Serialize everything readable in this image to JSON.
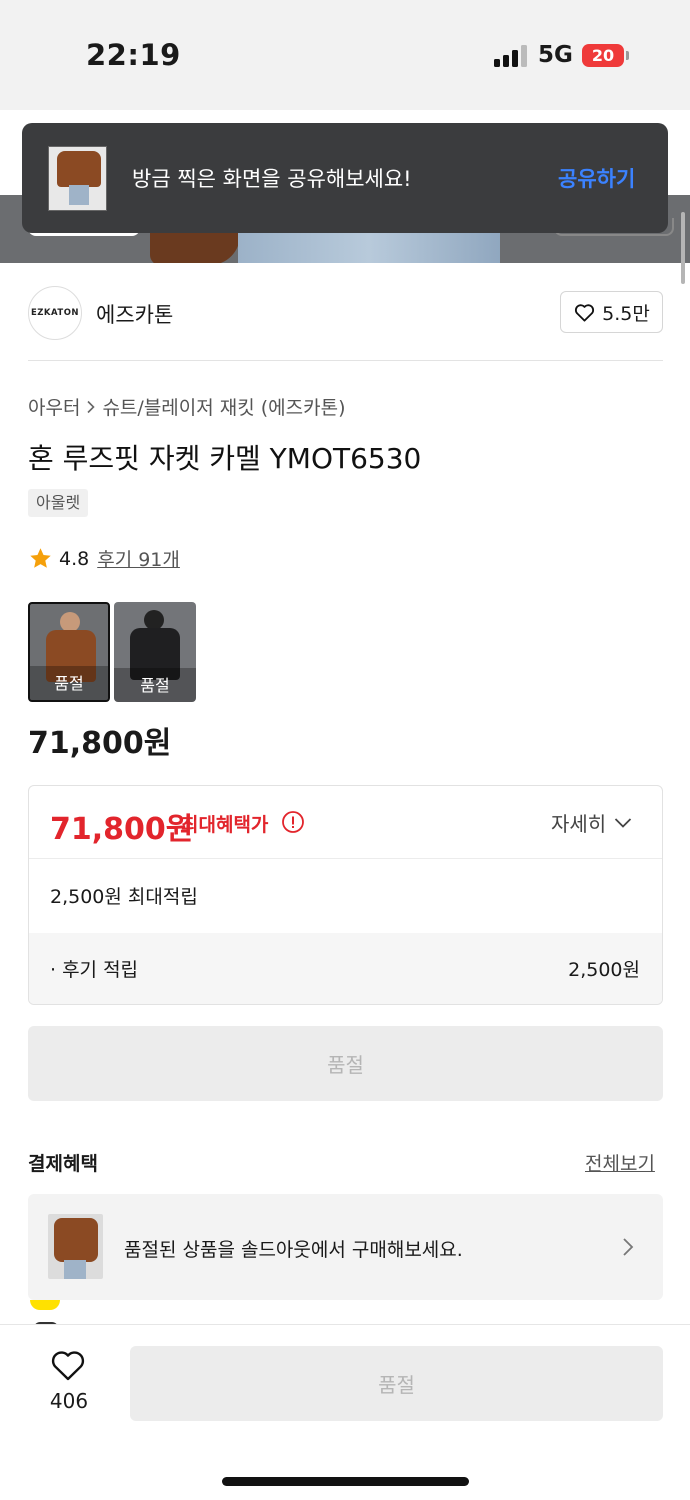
{
  "status_bar": {
    "time": "22:19",
    "network": "5G",
    "battery": "20"
  },
  "toast": {
    "message": "방금 찍은 화면을 공유해보세요!",
    "action": "공유하기"
  },
  "brand": {
    "logo_text": "EZKATON",
    "name": "에즈카톤",
    "likes": "5.5만"
  },
  "breadcrumb": {
    "category": "아우터",
    "subcategory": "슈트/블레이저 재킷 (에즈카톤)"
  },
  "product": {
    "title": "혼 루즈핏 자켓 카멜 YMOT6530",
    "tag": "아울렛",
    "rating": "4.8",
    "reviews": "후기 91개",
    "price": "71,800원",
    "options": [
      {
        "label": "품절"
      },
      {
        "label": "품절"
      }
    ]
  },
  "benefit": {
    "price": "71,800원",
    "price_label": "최대혜택가",
    "detail": "자세히",
    "points_total": "2,500원 최대적립",
    "review_points_label": "· 후기 적립",
    "review_points_value": "2,500원"
  },
  "soldout_label": "품절",
  "payment": {
    "title": "결제혜택",
    "view_all": "전체보기"
  },
  "promo": {
    "text": "품절된 상품을 솔드아웃에서 구매해보세요."
  },
  "bottom": {
    "wish_count": "406",
    "buy_label": "품절"
  },
  "colors": {
    "accent_red": "#e2252c",
    "link_blue": "#3b82ff",
    "star": "#f5a00b"
  }
}
